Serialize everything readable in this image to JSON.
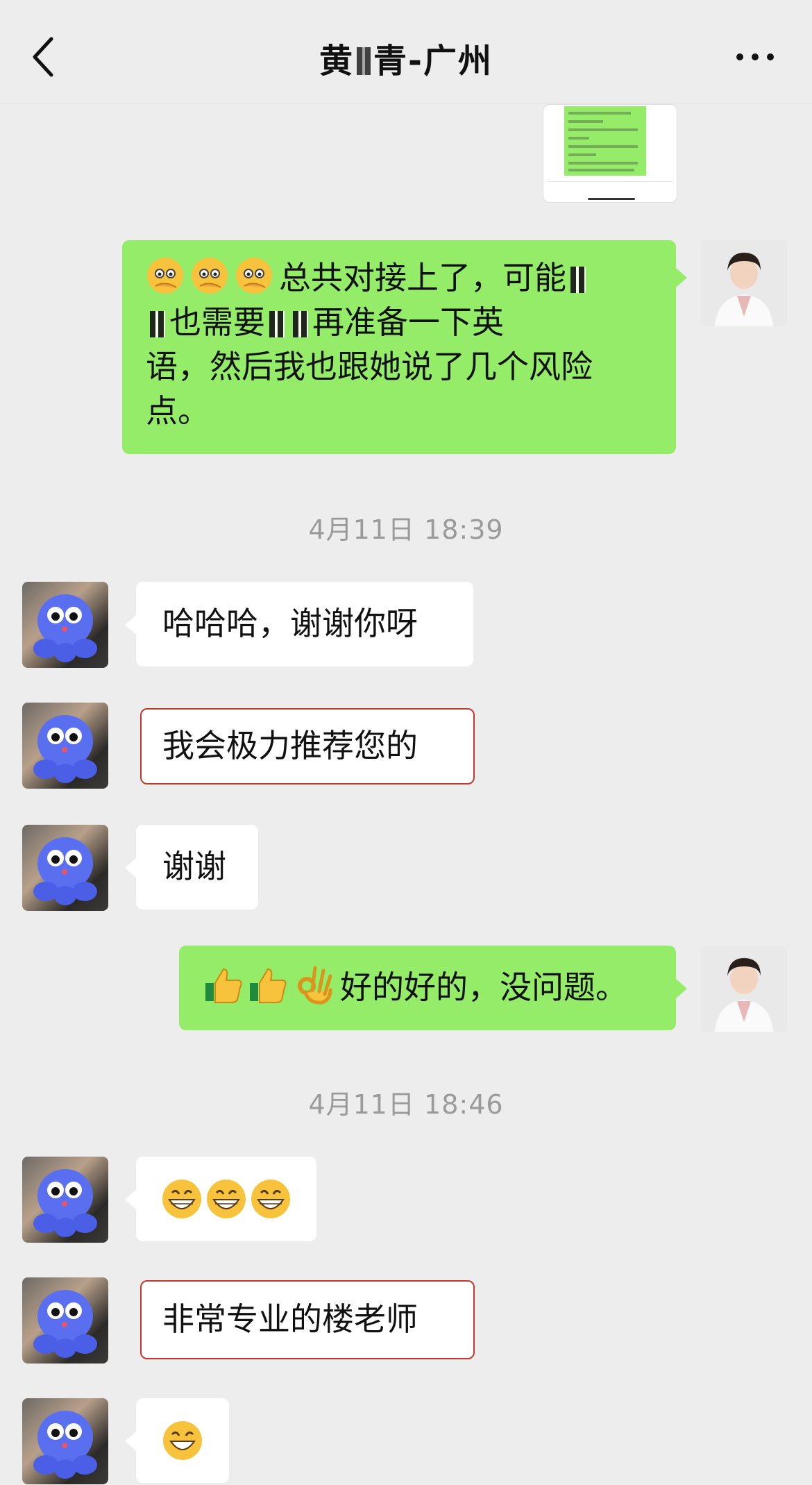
{
  "header": {
    "title_part1": "黄",
    "title_part2": "青-广州",
    "back_icon": "chevron-left-icon",
    "more_icon": "more-dots-icon"
  },
  "messages": {
    "m1_emoji": "peek-face-emoji",
    "m1_line1": "总共对接上了，可能",
    "m1_line2": "也需要",
    "m1_line2b": "再准备一下英",
    "m1_line3": "语，然后我也跟她说了几个风险",
    "m1_line4": "点。",
    "t1": "4月11日 18:39",
    "m2": "哈哈哈，谢谢你呀",
    "m3": "我会极力推荐您的",
    "m4": "谢谢",
    "m5_text": "好的好的，没问题。",
    "t2": "4月11日 18:46",
    "m6_emoji": "grin-emoji",
    "m7": "非常专业的楼老师",
    "m8_emoji": "smile-emoji"
  },
  "colors": {
    "background": "#ededed",
    "my_bubble": "#95ec69",
    "their_bubble": "#ffffff",
    "highlight_border": "#c0392b"
  }
}
